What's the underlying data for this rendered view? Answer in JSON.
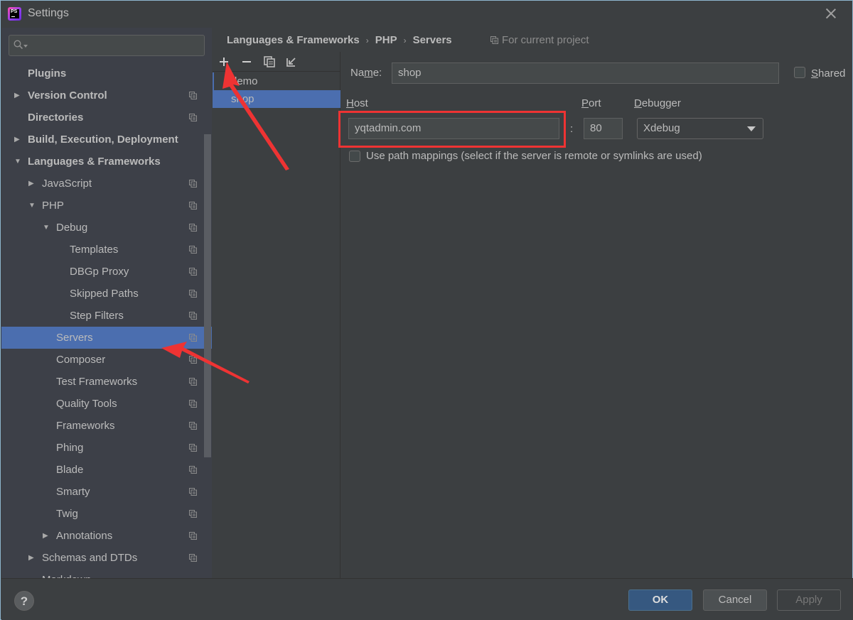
{
  "window": {
    "title": "Settings",
    "app_icon_label": "PS"
  },
  "sidebar": {
    "search_placeholder": "",
    "items": [
      {
        "label": "Plugins",
        "level": 0,
        "bold": true,
        "arrow": "",
        "project_icon": false
      },
      {
        "label": "Version Control",
        "level": 0,
        "bold": true,
        "arrow": "collapsed",
        "project_icon": true
      },
      {
        "label": "Directories",
        "level": 0,
        "bold": true,
        "arrow": "",
        "project_icon": true
      },
      {
        "label": "Build, Execution, Deployment",
        "level": 0,
        "bold": true,
        "arrow": "collapsed",
        "project_icon": false
      },
      {
        "label": "Languages & Frameworks",
        "level": 0,
        "bold": true,
        "arrow": "expanded",
        "project_icon": false
      },
      {
        "label": "JavaScript",
        "level": 1,
        "bold": false,
        "arrow": "collapsed",
        "project_icon": true
      },
      {
        "label": "PHP",
        "level": 1,
        "bold": false,
        "arrow": "expanded",
        "project_icon": true
      },
      {
        "label": "Debug",
        "level": 2,
        "bold": false,
        "arrow": "expanded",
        "project_icon": true
      },
      {
        "label": "Templates",
        "level": 3,
        "bold": false,
        "arrow": "",
        "project_icon": true
      },
      {
        "label": "DBGp Proxy",
        "level": 3,
        "bold": false,
        "arrow": "",
        "project_icon": true
      },
      {
        "label": "Skipped Paths",
        "level": 3,
        "bold": false,
        "arrow": "",
        "project_icon": true
      },
      {
        "label": "Step Filters",
        "level": 3,
        "bold": false,
        "arrow": "",
        "project_icon": true
      },
      {
        "label": "Servers",
        "level": 2,
        "bold": false,
        "arrow": "",
        "project_icon": true,
        "selected": true
      },
      {
        "label": "Composer",
        "level": 2,
        "bold": false,
        "arrow": "",
        "project_icon": true
      },
      {
        "label": "Test Frameworks",
        "level": 2,
        "bold": false,
        "arrow": "",
        "project_icon": true
      },
      {
        "label": "Quality Tools",
        "level": 2,
        "bold": false,
        "arrow": "",
        "project_icon": true
      },
      {
        "label": "Frameworks",
        "level": 2,
        "bold": false,
        "arrow": "",
        "project_icon": true
      },
      {
        "label": "Phing",
        "level": 2,
        "bold": false,
        "arrow": "",
        "project_icon": true
      },
      {
        "label": "Blade",
        "level": 2,
        "bold": false,
        "arrow": "",
        "project_icon": true
      },
      {
        "label": "Smarty",
        "level": 2,
        "bold": false,
        "arrow": "",
        "project_icon": true
      },
      {
        "label": "Twig",
        "level": 2,
        "bold": false,
        "arrow": "",
        "project_icon": true
      },
      {
        "label": "Annotations",
        "level": 2,
        "bold": false,
        "arrow": "collapsed",
        "project_icon": true
      },
      {
        "label": "Schemas and DTDs",
        "level": 1,
        "bold": false,
        "arrow": "collapsed",
        "project_icon": true
      },
      {
        "label": "Markdown",
        "level": 1,
        "bold": false,
        "arrow": "",
        "project_icon": false
      }
    ]
  },
  "breadcrumb": {
    "items": [
      "Languages & Frameworks",
      "PHP",
      "Servers"
    ],
    "separator": "›",
    "scope_label": "For current project"
  },
  "servers": {
    "toolbar": {
      "add": "add-icon",
      "remove": "remove-icon",
      "copy": "copy-icon",
      "import": "import-icon"
    },
    "list": [
      {
        "name": "demo",
        "selected": false
      },
      {
        "name": "shop",
        "selected": true
      }
    ]
  },
  "form": {
    "name_label_pre": "Na",
    "name_label_ul": "m",
    "name_label_post": "e:",
    "name_value": "shop",
    "shared_label_ul": "S",
    "shared_label_rest": "hared",
    "shared_checked": false,
    "host_label_ul": "H",
    "host_label_rest": "ost",
    "host_value": "yqtadmin.com",
    "colon": ":",
    "port_label_ul": "P",
    "port_label_rest": "ort",
    "port_value": "80",
    "debugger_label_ul": "D",
    "debugger_label_rest": "ebugger",
    "debugger_value": "Xdebug",
    "path_mappings_label": "Use path mappings (select if the server is remote or symlinks are used)",
    "path_mappings_checked": false
  },
  "footer": {
    "help": "?",
    "ok": "OK",
    "cancel": "Cancel",
    "apply": "Apply"
  },
  "colors": {
    "selection": "#4b6eaf",
    "annotation": "#ee3333",
    "ok_button": "#365880"
  }
}
